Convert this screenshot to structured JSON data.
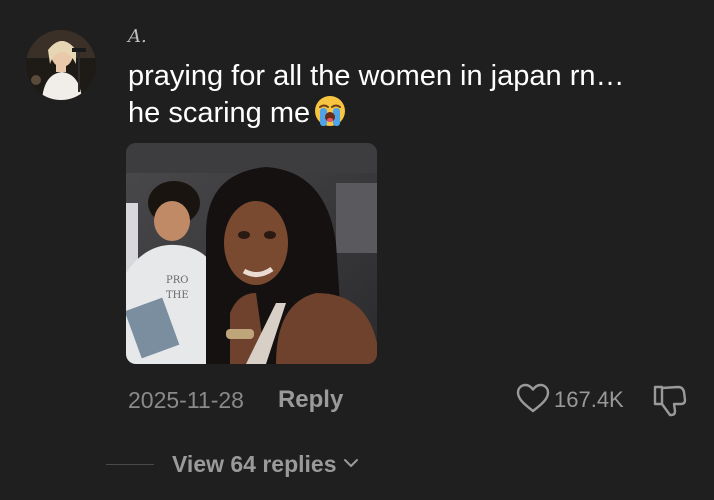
{
  "comment": {
    "username": "A.",
    "text_line1": "praying for all the women in japan rn…",
    "text_line2": "he scaring me",
    "emoji": "loudly-crying-face-emoji",
    "date": "2025-11-28",
    "reply_label": "Reply",
    "like_count": "167.4K",
    "view_replies_label": "View 64 replies"
  },
  "icons": {
    "like": "heart-outline-icon",
    "dislike": "thumbs-down-outline-icon",
    "expand": "chevron-down-icon"
  },
  "colors": {
    "background": "#1f1f1f",
    "text_primary": "#ffffff",
    "text_secondary": "#8a8a8a",
    "action_gray": "#9a9a9a"
  }
}
